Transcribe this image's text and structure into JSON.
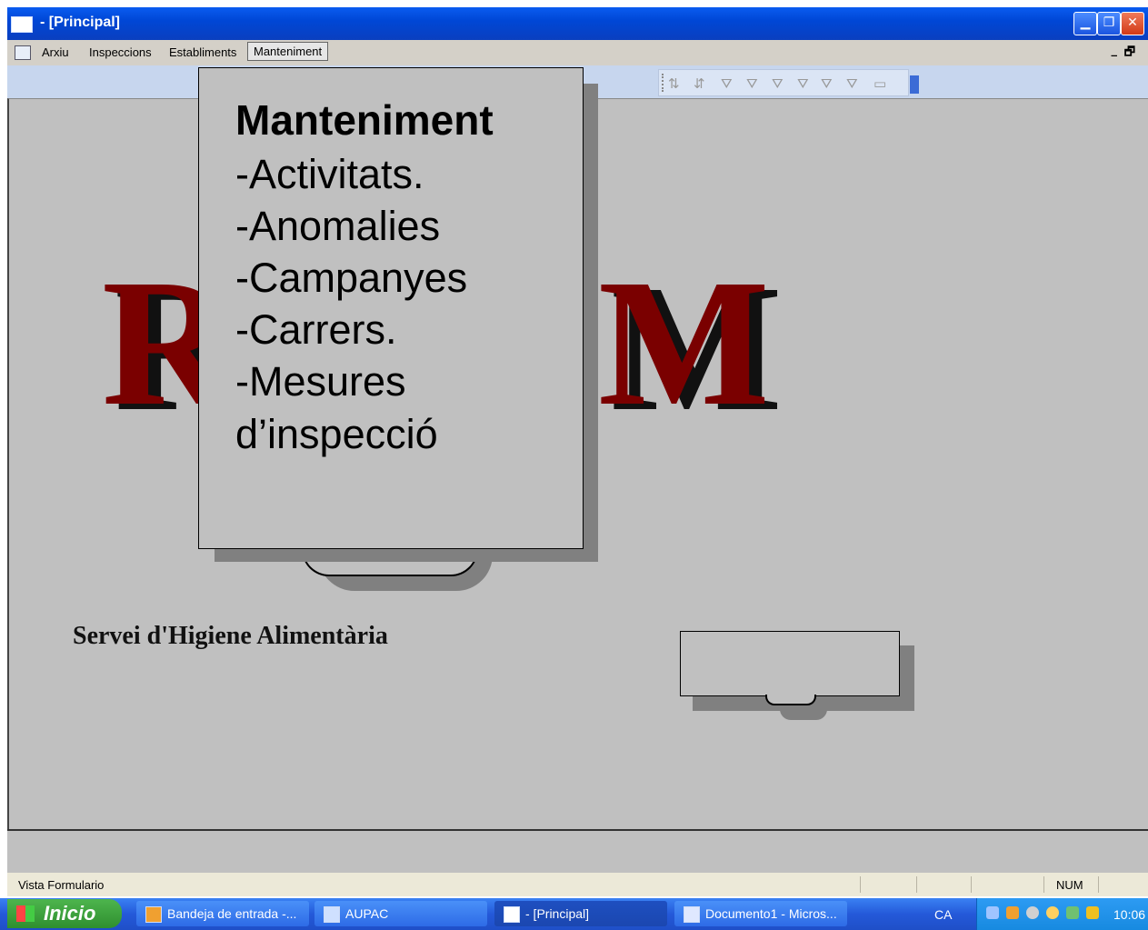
{
  "window": {
    "title": " - [Principal]"
  },
  "menubar": {
    "items": [
      "Arxiu",
      "Inspeccions",
      "Establiments",
      "Manteniment"
    ],
    "open_item": "Manteniment"
  },
  "form": {
    "logo_text": "RM",
    "service": "Servei d'Higiene Alimentària"
  },
  "callout": {
    "heading": "Manteniment",
    "items": [
      "-Activitats.",
      "-Anomalies",
      "-Campanyes",
      "-Carrers.",
      "-Mesures",
      "d’inspecció"
    ]
  },
  "statusbar": {
    "text": "Vista Formulario",
    "num": "NUM"
  },
  "taskbar": {
    "start": "Inicio",
    "tasks": [
      "Bandeja de entrada -...",
      "AUPAC",
      " - [Principal]",
      "Documento1 - Micros..."
    ],
    "language": "CA",
    "clock": "10:06"
  }
}
